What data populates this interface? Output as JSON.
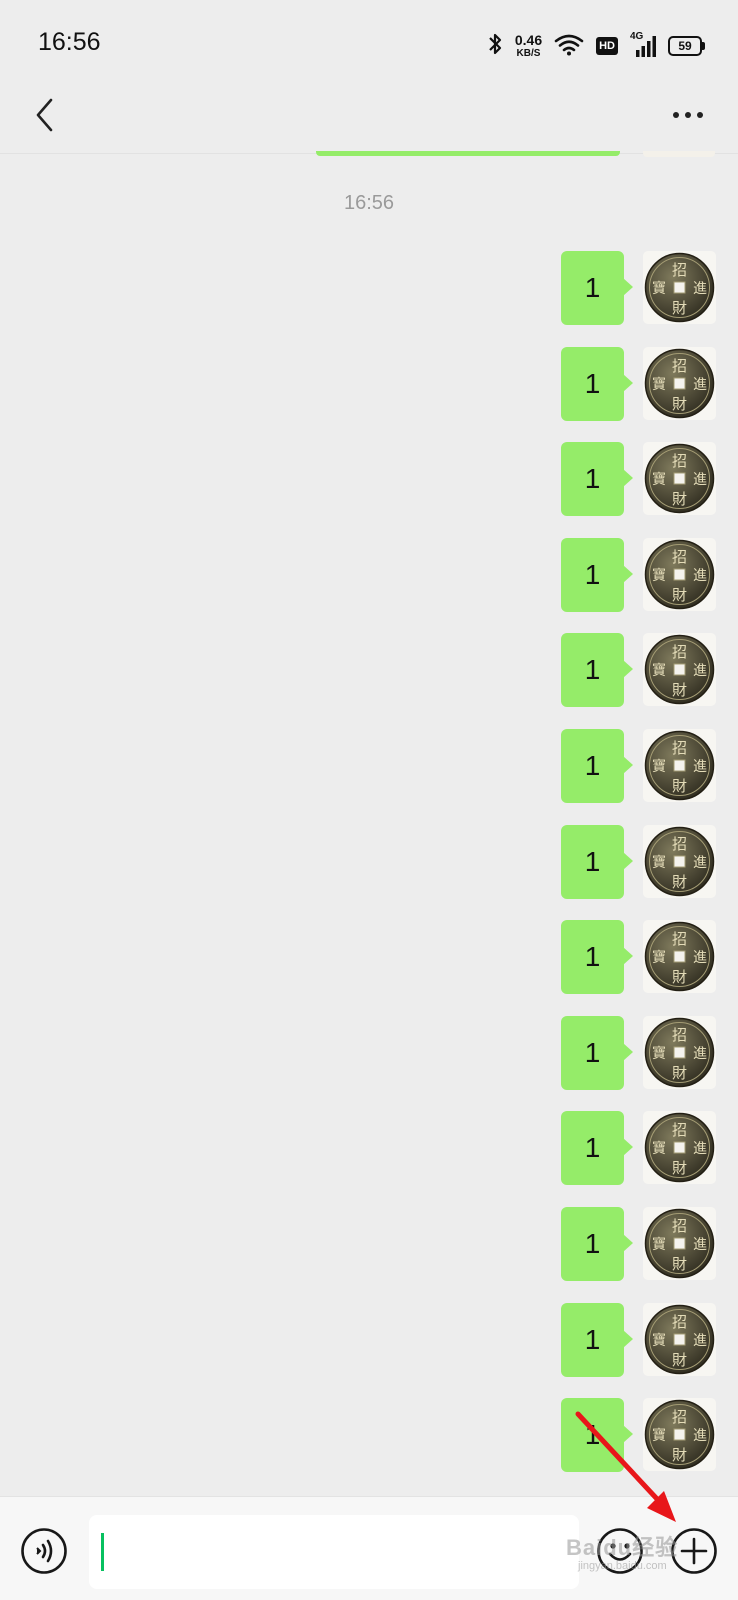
{
  "status_bar": {
    "time": "16:56",
    "net_speed_value": "0.46",
    "net_speed_unit": "KB/S",
    "hd_label": "HD",
    "network_label": "4G",
    "battery_level": "59",
    "icons": [
      "bluetooth-icon",
      "wifi-icon",
      "hd-icon",
      "signal-4g-icon",
      "battery-icon"
    ]
  },
  "nav": {
    "back_icon": "chevron-left-icon",
    "more_icon": "more-dots-icon"
  },
  "chat": {
    "timestamp": "16:56",
    "bubble_color": "#95ec69",
    "messages": [
      {
        "text": "1"
      },
      {
        "text": "1"
      },
      {
        "text": "1"
      },
      {
        "text": "1"
      },
      {
        "text": "1"
      },
      {
        "text": "1"
      },
      {
        "text": "1"
      },
      {
        "text": "1"
      },
      {
        "text": "1"
      },
      {
        "text": "1"
      },
      {
        "text": "1"
      },
      {
        "text": "1"
      },
      {
        "text": "1"
      }
    ],
    "avatar_glyphs": [
      "招",
      "進",
      "財",
      "寶"
    ]
  },
  "input_bar": {
    "input_value": "",
    "voice_icon": "voice-icon",
    "emoji_icon": "emoji-icon",
    "add_icon": "plus-circle-icon"
  },
  "watermark": {
    "text": "Baidu经验",
    "sub": "jingyan.baidu.com"
  },
  "annotation": {
    "arrow_color": "#e8161a"
  }
}
